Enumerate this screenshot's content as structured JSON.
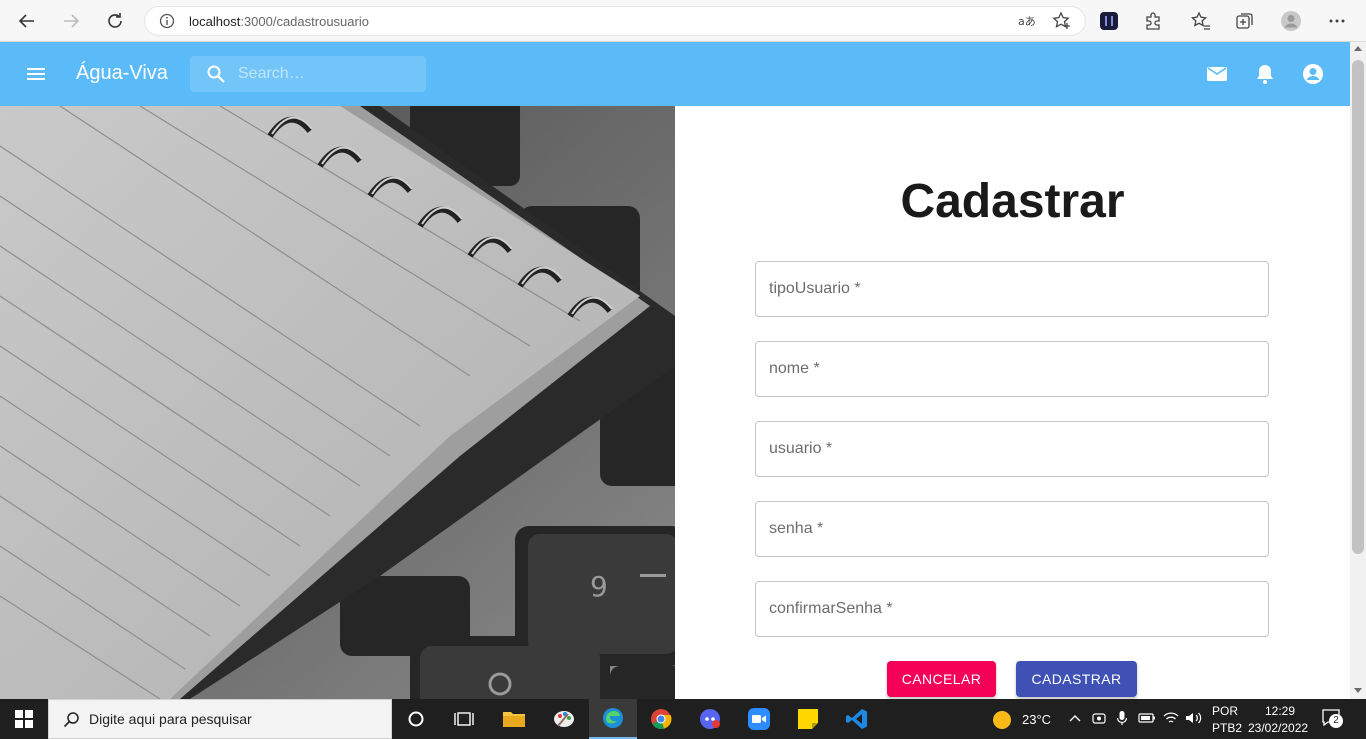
{
  "browser": {
    "url_host": "localhost",
    "url_path": ":3000/cadastrousuario"
  },
  "appbar": {
    "title": "Água-Viva",
    "search_placeholder": "Search…"
  },
  "form": {
    "title": "Cadastrar",
    "fields": [
      {
        "label": "tipoUsuario *"
      },
      {
        "label": "nome *"
      },
      {
        "label": "usuario *"
      },
      {
        "label": "senha *"
      },
      {
        "label": "confirmarSenha *"
      }
    ],
    "cancel_label": "CANCELAR",
    "submit_label": "CADASTRAR"
  },
  "colors": {
    "appbar": "#5bbbf8",
    "cancel": "#f50057",
    "submit": "#3f51b5"
  },
  "taskbar": {
    "search_placeholder": "Digite aqui para pesquisar",
    "weather": "23°C",
    "lang_line1": "POR",
    "lang_line2": "PTB2",
    "time": "12:29",
    "date": "23/02/2022",
    "notification_count": "2"
  }
}
